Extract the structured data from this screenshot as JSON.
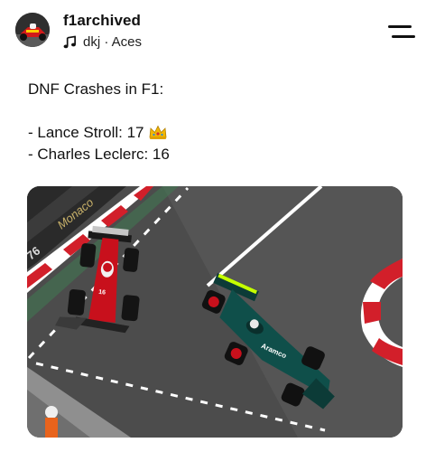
{
  "header": {
    "username": "f1archived",
    "music": {
      "icon": "music-note-icon",
      "text": "dkj · Aces"
    },
    "menu_icon": "menu-icon"
  },
  "post": {
    "caption": {
      "title": "DNF Crashes in F1:",
      "items": [
        {
          "text": "- Lance Stroll: 17",
          "badge": "crown-icon"
        },
        {
          "text": "- Charles Leclerc: 16"
        }
      ]
    },
    "image": {
      "subject": "race-photo",
      "car_sponsor_text": "Aramco"
    }
  },
  "colors": {
    "text": "#111111",
    "ferrari_red": "#c8101c",
    "aston_green": "#0f4f4a",
    "lime": "#c6ff00",
    "track": "#4a4a4a"
  }
}
